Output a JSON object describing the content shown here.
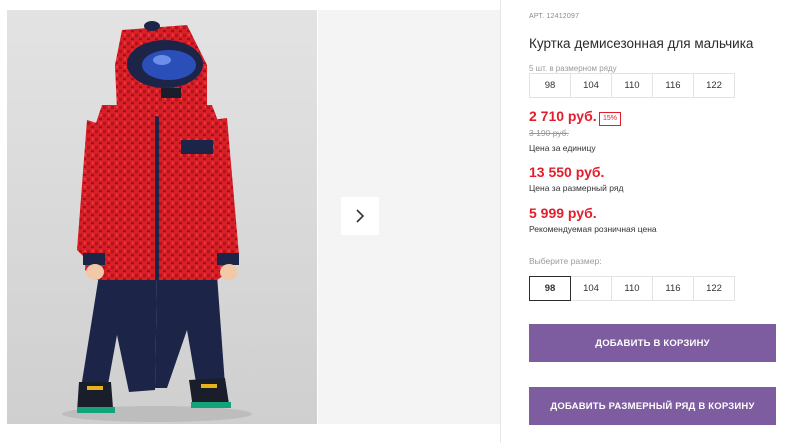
{
  "product": {
    "sku": "АРТ. 12412097",
    "title": "Куртка демисезонная для мальчика",
    "image_alt": "boy-in-red-winter-jacket-photo"
  },
  "size_row_info": {
    "count_text": "5 шт. в размерном ряду",
    "sizes": [
      "98",
      "104",
      "110",
      "116",
      "122"
    ]
  },
  "prices": {
    "unit_price": "2 710 руб.",
    "discount": "15%",
    "old_price": "3 190 руб.",
    "unit_label": "Цена за единицу",
    "row_price": "13 550 руб.",
    "row_label": "Цена за размерный ряд",
    "rrp": "5 999 руб.",
    "rrp_label": "Рекомендуемая розничная цена"
  },
  "size_select": {
    "label": "Выберите размер:",
    "sizes": [
      "98",
      "104",
      "110",
      "116",
      "122"
    ],
    "selected": "98"
  },
  "buttons": {
    "add_to_cart": "ДОБАВИТЬ В КОРЗИНУ",
    "add_row_to_cart": "ДОБАВИТЬ РАЗМЕРНЫЙ РЯД В КОРЗИНУ"
  },
  "colors": {
    "price_red": "#e31e2c",
    "button_purple": "#7d5ca0",
    "jacket_red": "#d81e26",
    "pants_navy": "#1c2447"
  },
  "icons": {
    "next": "chevron-right-icon"
  }
}
